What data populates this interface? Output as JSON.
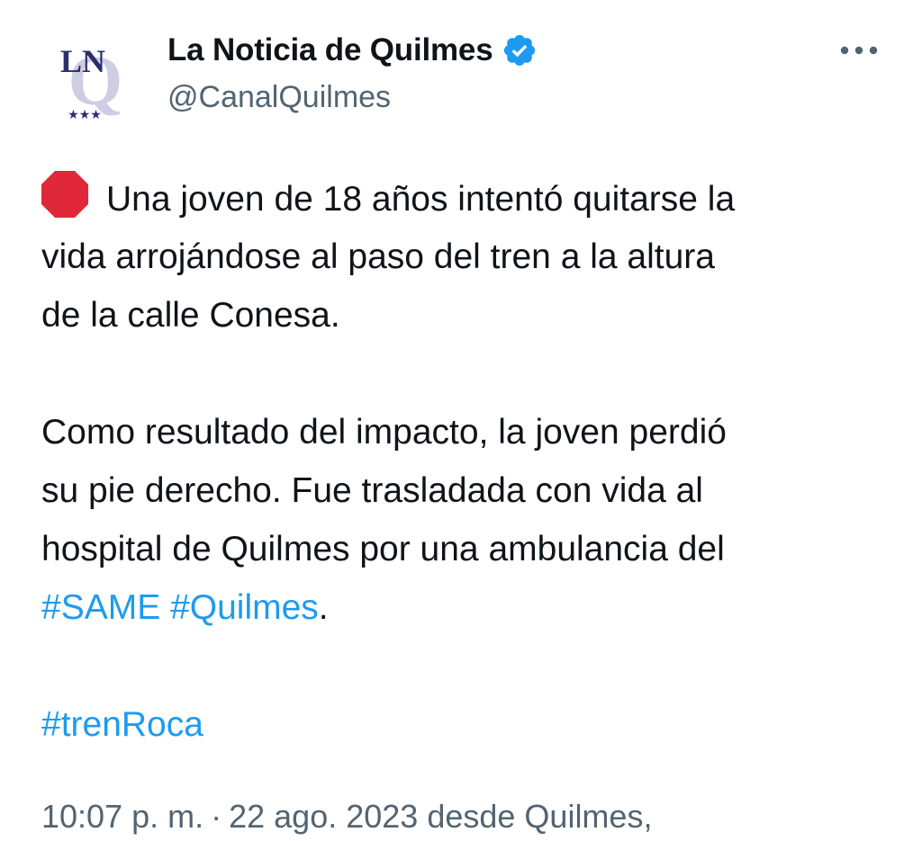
{
  "author": {
    "display_name": "La Noticia de Quilmes",
    "handle": "@CanalQuilmes",
    "verified": true,
    "avatar_initials": "LN",
    "avatar_letter": "Q",
    "avatar_stars": "★★★"
  },
  "tweet": {
    "stop_emoji": "stop-sign-icon",
    "lines": [
      "Una joven de 18 años intentó quitarse la",
      "vida arrojándose al paso del tren a la altura",
      "de la calle Conesa.",
      "Como resultado del impacto, la joven perdió",
      "su pie derecho. Fue trasladada con vida al",
      "hospital de Quilmes por una ambulancia del"
    ],
    "hashtags_line": [
      "#SAME",
      "#Quilmes"
    ],
    "hashtags_line_suffix": ".",
    "hashtag_final": "#trenRoca"
  },
  "meta": {
    "time": "10:07 p. m.",
    "separator": "·",
    "date": "22 ago. 2023",
    "source": "desde Quilmes,"
  },
  "colors": {
    "text": "#0f1419",
    "secondary": "#536471",
    "link": "#1d9bf0",
    "verified": "#1d9bf0",
    "stop_sign": "#e0283a",
    "avatar_text": "#2b2e6e",
    "avatar_q": "#c8c6dc"
  },
  "icons": {
    "more": "more-icon",
    "verified": "verified-badge-icon"
  }
}
